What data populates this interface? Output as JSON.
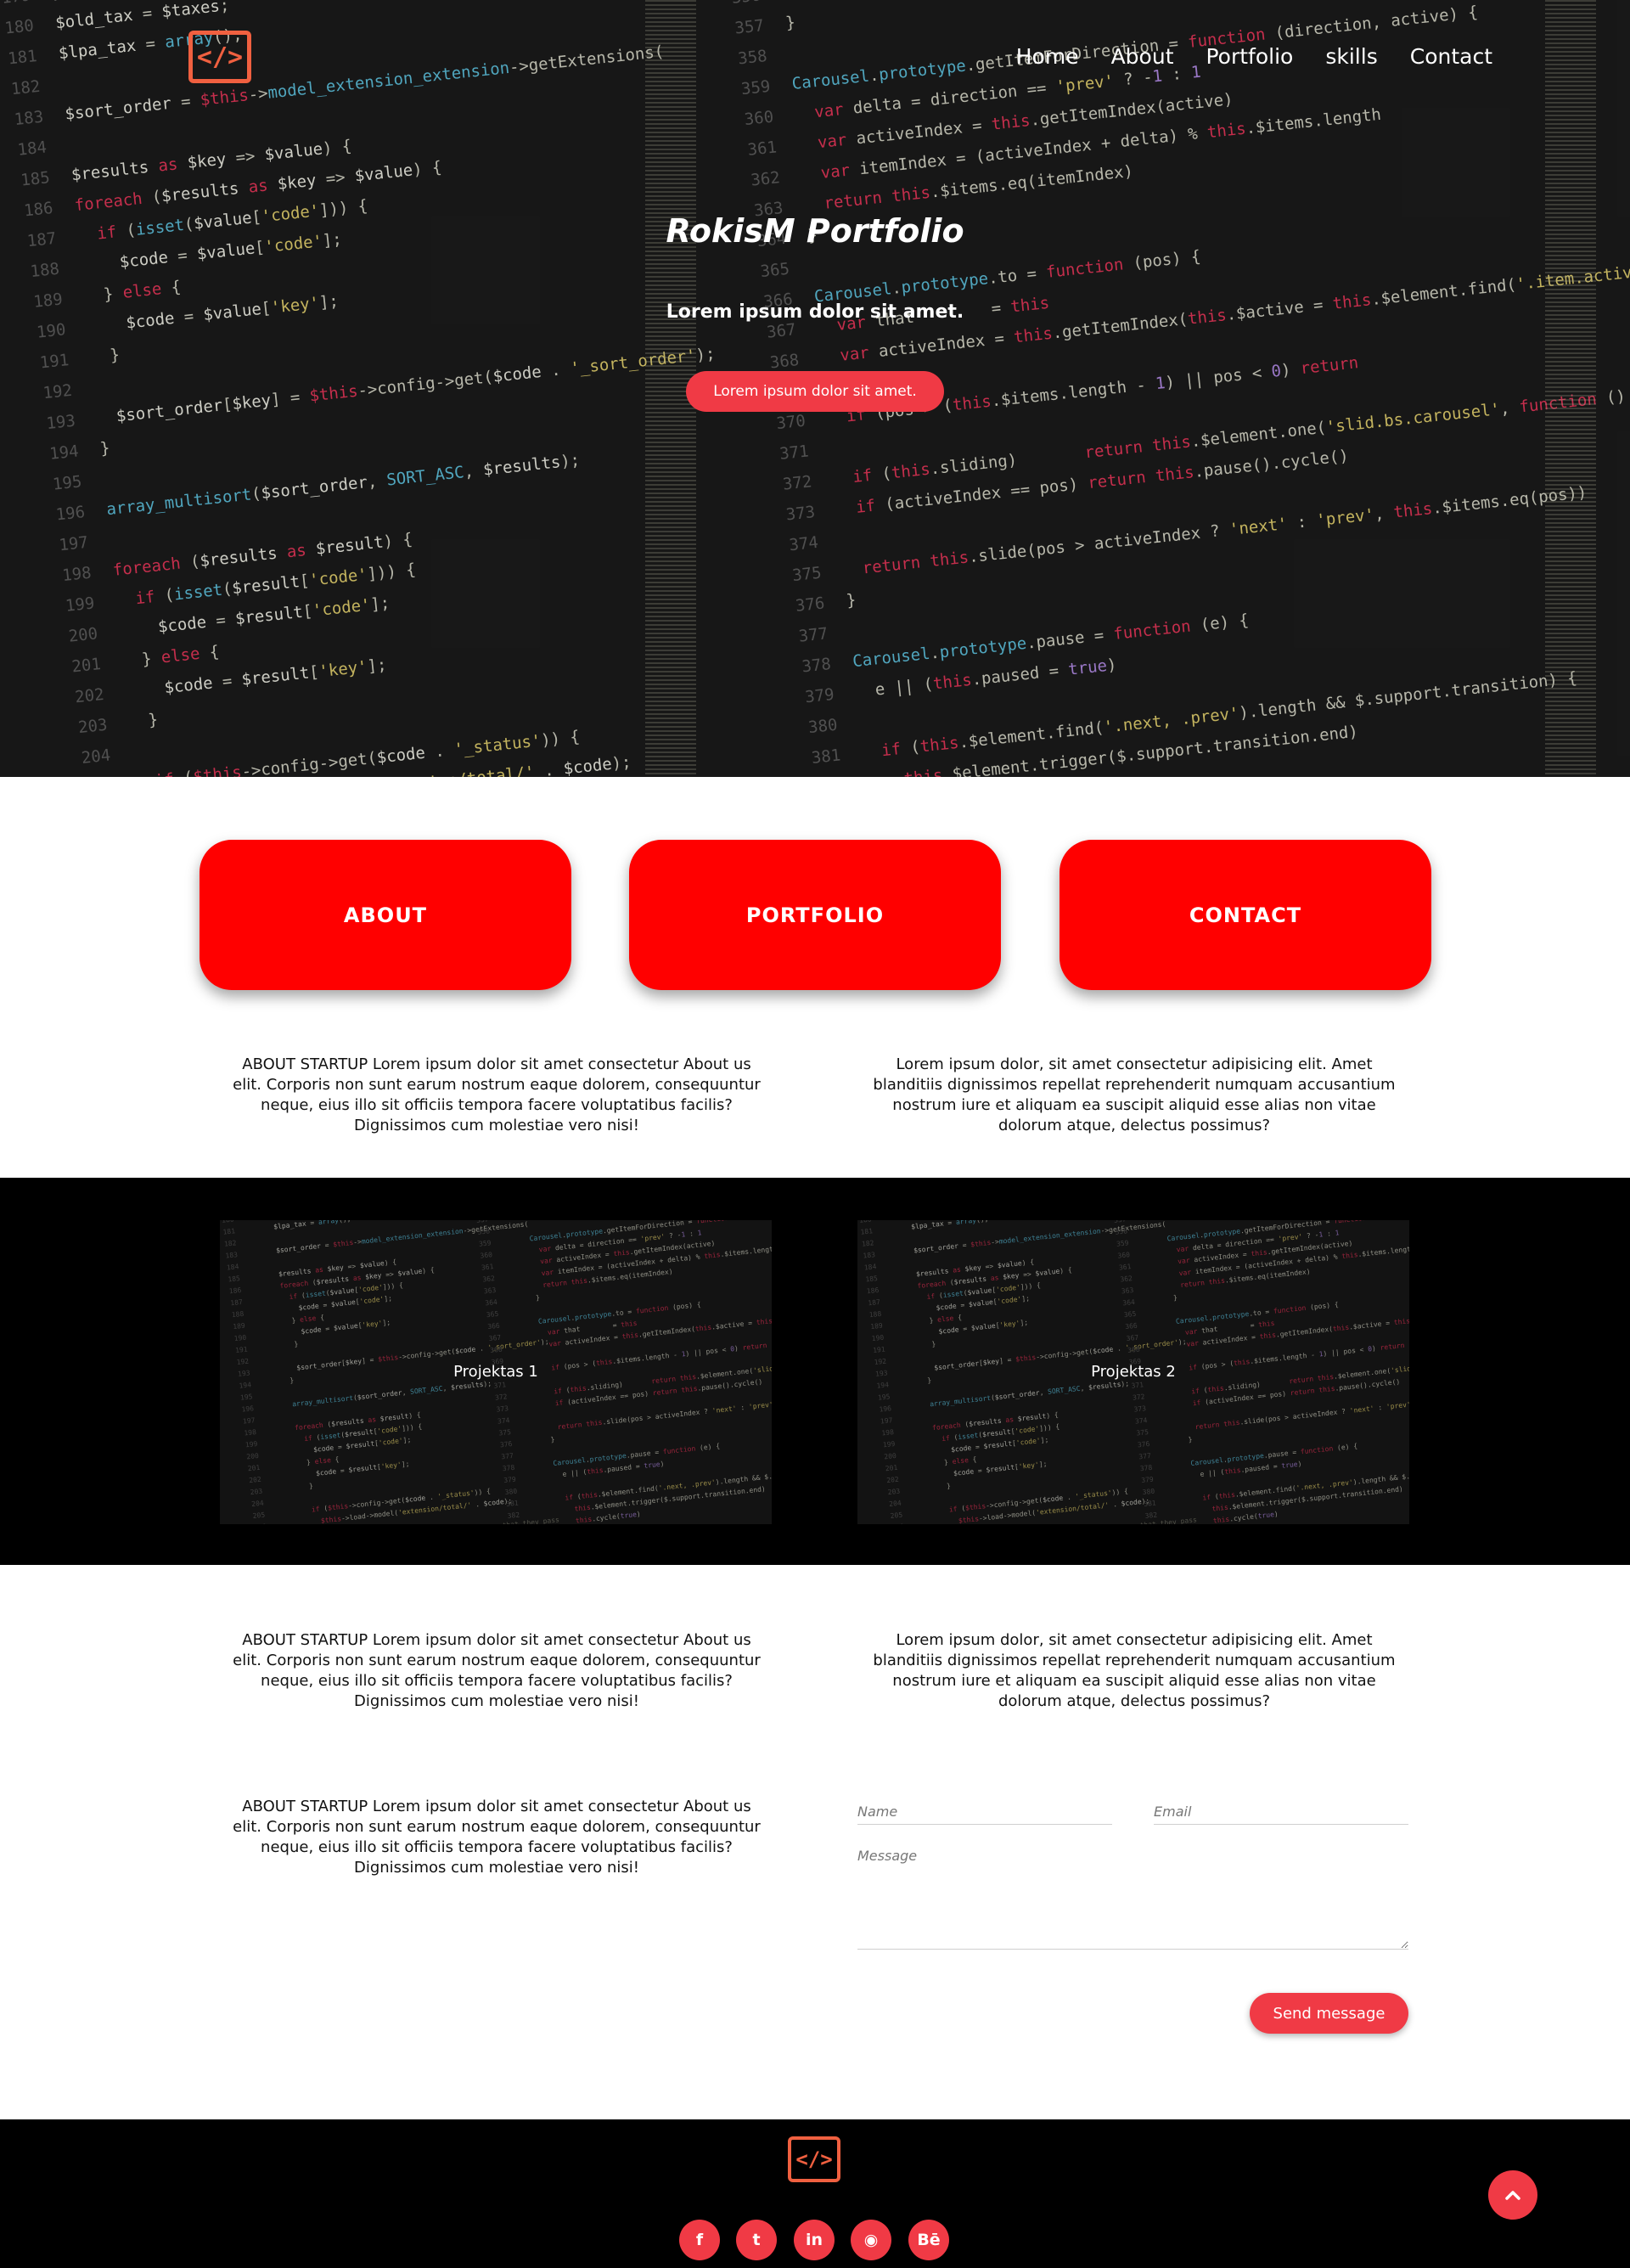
{
  "header": {
    "logo_icon": "code-brackets-icon",
    "nav": [
      "Home",
      "About",
      "Portfolio",
      "skills",
      "Contact"
    ]
  },
  "hero": {
    "title": "RokisM Portfolio",
    "subtitle": "Lorem ipsum dolor sit amet.",
    "button": "Lorem ipsum dolor sit amet."
  },
  "cards": [
    "ABOUT",
    "PORTFOLIO",
    "CONTACT"
  ],
  "section1": {
    "left": "ABOUT STARTUP Lorem ipsum dolor sit amet consectetur About us elit. Corporis non sunt earum nostrum eaque dolorem, consequuntur neque, eius illo sit officiis tempora facere voluptatibus facilis? Dignissimos cum molestiae vero nisi!",
    "right": "Lorem ipsum dolor, sit amet consectetur adipisicing elit. Amet blanditiis dignissimos repellat reprehenderit numquam accusantium nostrum iure et aliquam ea suscipit aliquid esse alias non vitae dolorum atque, delectus possimus?"
  },
  "portfolio": [
    "Projektas 1",
    "Projektas 2"
  ],
  "section2": {
    "left": "ABOUT STARTUP Lorem ipsum dolor sit amet consectetur About us elit. Corporis non sunt earum nostrum eaque dolorem, consequuntur neque, eius illo sit officiis tempora facere voluptatibus facilis? Dignissimos cum molestiae vero nisi!",
    "right": "Lorem ipsum dolor, sit amet consectetur adipisicing elit. Amet blanditiis dignissimos repellat reprehenderit numquam accusantium nostrum iure et aliquam ea suscipit aliquid esse alias non vitae dolorum atque, delectus possimus?"
  },
  "contact": {
    "text": "ABOUT STARTUP Lorem ipsum dolor sit amet consectetur About us elit. Corporis non sunt earum nostrum eaque dolorem, consequuntur neque, eius illo sit officiis tempora facere voluptatibus facilis? Dignissimos cum molestiae vero nisi!",
    "name_placeholder": "Name",
    "email_placeholder": "Email",
    "message_placeholder": "Message",
    "send": "Send message"
  },
  "footer": {
    "social": [
      {
        "icon": "facebook-icon",
        "glyph": "f"
      },
      {
        "icon": "twitter-icon",
        "glyph": "t"
      },
      {
        "icon": "linkedin-icon",
        "glyph": "in"
      },
      {
        "icon": "github-icon",
        "glyph": "◉"
      },
      {
        "icon": "behance-icon",
        "glyph": "Bē"
      }
    ],
    "to_top_icon": "chevron-up-icon"
  },
  "colors": {
    "accent": "#f03a45",
    "card_red": "#ff0000",
    "logo_orange": "#f06040"
  }
}
